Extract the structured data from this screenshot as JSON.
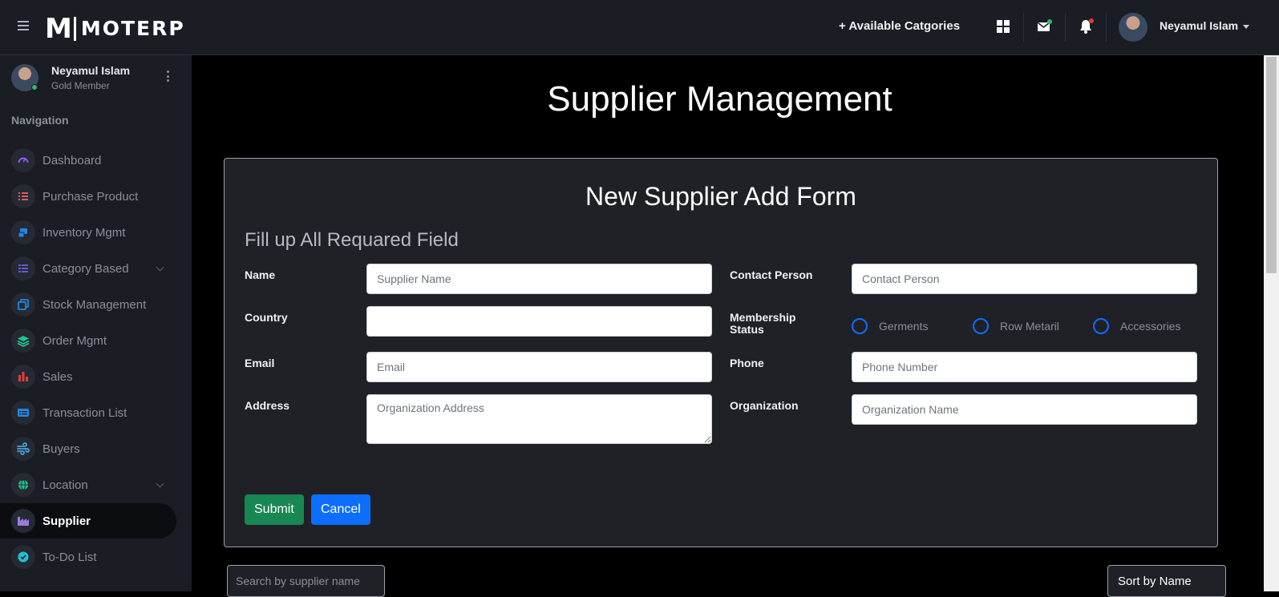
{
  "app": {
    "logo_m": "M",
    "logo_text": "MOTERP"
  },
  "topbar": {
    "categories_link": "+ Available Catgories",
    "user_name": "Neyamul Islam",
    "icons": [
      "apps-grid-icon",
      "mail-icon",
      "bell-icon"
    ],
    "notification_colors": {
      "mail": "#2dbb67",
      "bell": "#e53935"
    }
  },
  "sidebar": {
    "profile_name": "Neyamul Islam",
    "profile_role": "Gold Member",
    "nav_title": "Navigation",
    "items": [
      {
        "label": "Dashboard",
        "icon": "gauge-icon",
        "color": "#8b5cf6"
      },
      {
        "label": "Purchase Product",
        "icon": "list-icon",
        "color": "#e25c5c"
      },
      {
        "label": "Inventory Mgmt",
        "icon": "inventory-icon",
        "color": "#1e88e5"
      },
      {
        "label": "Category Based",
        "icon": "list-check-icon",
        "color": "#6b5bd6",
        "expandable": true
      },
      {
        "label": "Stock Management",
        "icon": "copy-icon",
        "color": "#1e88e5"
      },
      {
        "label": "Order Mgmt",
        "icon": "layers-icon",
        "color": "#22c38e"
      },
      {
        "label": "Sales",
        "icon": "bar-chart-icon",
        "color": "#e53935"
      },
      {
        "label": "Transaction List",
        "icon": "card-list-icon",
        "color": "#1e88e5"
      },
      {
        "label": "Buyers",
        "icon": "wind-icon",
        "color": "#4aa3e0"
      },
      {
        "label": "Location",
        "icon": "globe-icon",
        "color": "#22c38e",
        "expandable": true
      },
      {
        "label": "Supplier",
        "icon": "factory-icon",
        "color": "#9b7be0",
        "active": true
      },
      {
        "label": "To-Do List",
        "icon": "check-circle-icon",
        "color": "#22c1d8"
      }
    ]
  },
  "main": {
    "title": "Supplier Management",
    "form": {
      "title": "New Supplier Add Form",
      "subtitle": "Fill up All Requared Field",
      "name_label": "Name",
      "name_placeholder": "Supplier Name",
      "contact_label": "Contact Person",
      "contact_placeholder": "Contact Person",
      "country_label": "Country",
      "country_value": "",
      "membership_label": "Membership Status",
      "membership_options": [
        "Germents",
        "Row Metaril",
        "Accessories"
      ],
      "email_label": "Email",
      "email_placeholder": "Email",
      "phone_label": "Phone",
      "phone_placeholder": "Phone Number",
      "address_label": "Address",
      "address_placeholder": "Organization Address",
      "organization_label": "Organization",
      "organization_placeholder": "Organization Name",
      "submit_label": "Submit",
      "cancel_label": "Cancel"
    },
    "search_placeholder": "Search by supplier name",
    "sort_label": "Sort by Name"
  }
}
